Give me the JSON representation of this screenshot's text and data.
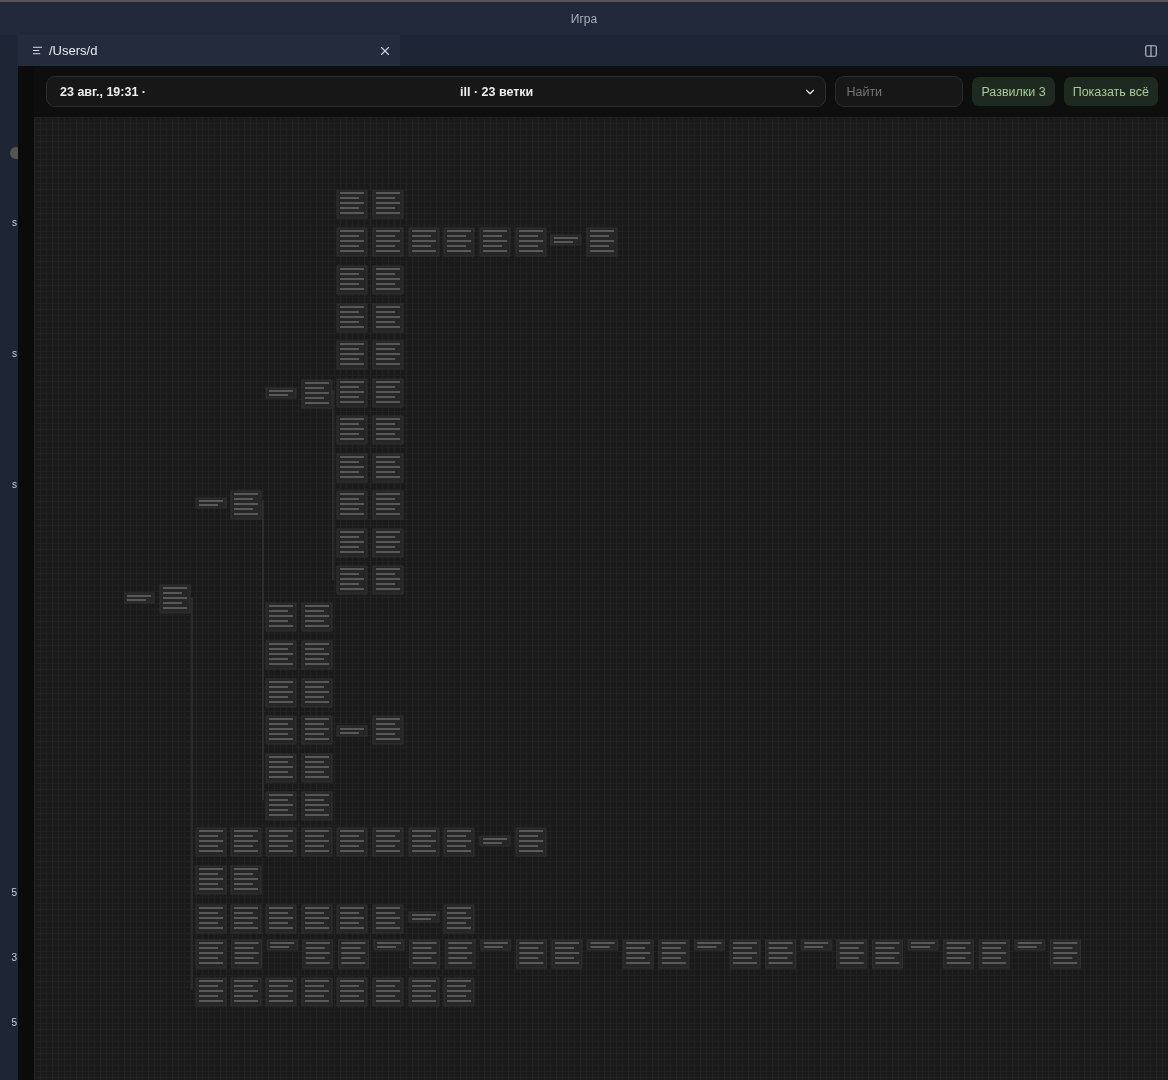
{
  "window": {
    "title": "Игра"
  },
  "tabs": [
    {
      "label": "/Users/d",
      "selected": true
    }
  ],
  "sidebar": {
    "fragments": [
      "s",
      "s",
      "s",
      "5",
      "3",
      "5"
    ]
  },
  "toolbar": {
    "session": {
      "date": "23 авг., 19:31 ·",
      "summary": "ill · 23 ветки"
    },
    "search": {
      "placeholder": "Найти"
    },
    "buttons": [
      {
        "label": "Развилки 3"
      },
      {
        "label": "Показать всё"
      }
    ]
  }
}
